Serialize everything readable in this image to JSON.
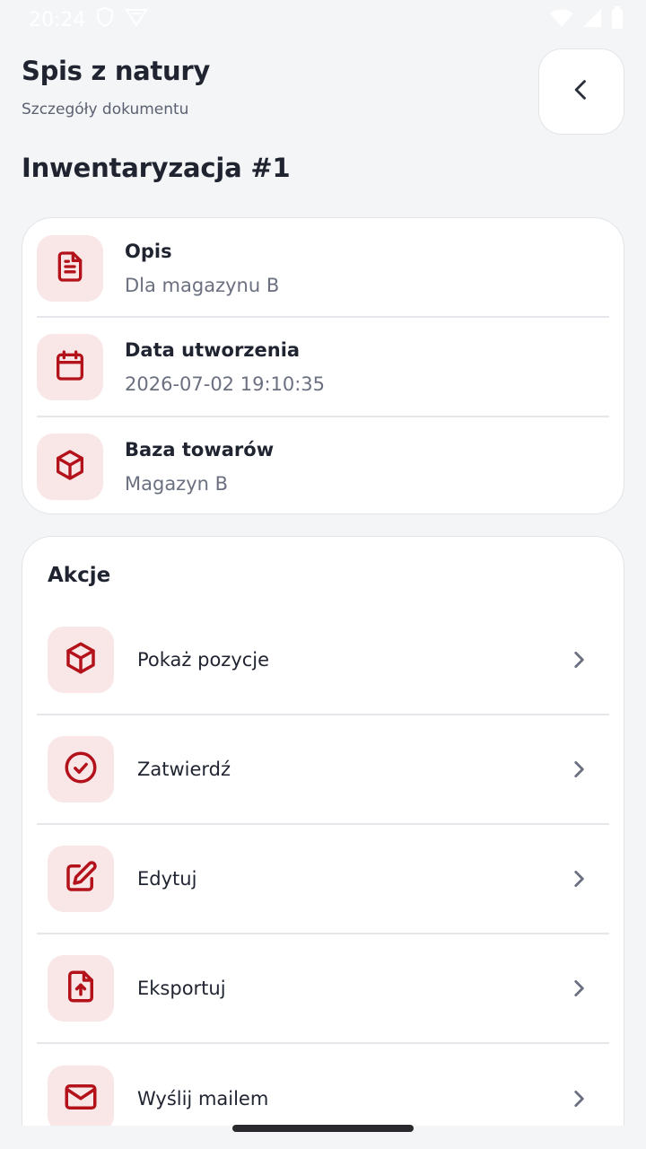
{
  "status_bar": {
    "time": "20:24"
  },
  "header": {
    "title": "Spis z natury",
    "subtitle": "Szczegóły dokumentu"
  },
  "document": {
    "title": "Inwentaryzacja #1"
  },
  "details": [
    {
      "icon": "document-icon",
      "label": "Opis",
      "value": "Dla magazynu B"
    },
    {
      "icon": "calendar-icon",
      "label": "Data utworzenia",
      "value": "2026-07-02 19:10:35"
    },
    {
      "icon": "box-icon",
      "label": "Baza towarów",
      "value": "Magazyn B"
    }
  ],
  "actions": {
    "title": "Akcje",
    "items": [
      {
        "icon": "box-icon",
        "label": "Pokaż pozycje"
      },
      {
        "icon": "check-circle-icon",
        "label": "Zatwierdź"
      },
      {
        "icon": "edit-icon",
        "label": "Edytuj"
      },
      {
        "icon": "file-upload-icon",
        "label": "Eksportuj"
      },
      {
        "icon": "mail-icon",
        "label": "Wyślij mailem"
      }
    ]
  },
  "colors": {
    "accent": "#b3121b",
    "icon_bg": "#f9e6e6",
    "background": "#f4f5f7"
  }
}
